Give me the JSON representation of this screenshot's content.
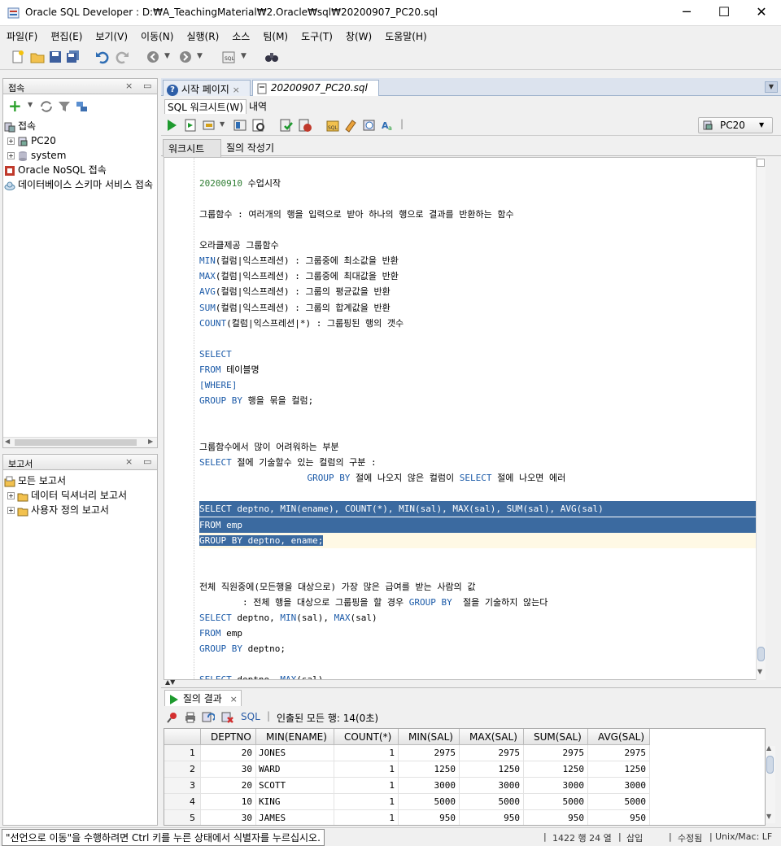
{
  "window": {
    "title": "Oracle SQL Developer : D:₩A_TeachingMaterial₩2.Oracle₩sql₩20200907_PC20.sql",
    "minimize": "─",
    "maximize": "☐",
    "close": "✕"
  },
  "menu": [
    "파일(F)",
    "편집(E)",
    "보기(V)",
    "이동(N)",
    "실행(R)",
    "소스",
    "팀(M)",
    "도구(T)",
    "창(W)",
    "도움말(H)"
  ],
  "connections": {
    "title": "접속",
    "root": "접속",
    "items": [
      "PC20",
      "system"
    ],
    "nosql": "Oracle NoSQL 접속",
    "schema": "데이터베이스 스키마 서비스 접속"
  },
  "reports": {
    "title": "보고서",
    "items": [
      "모든 보고서",
      "데이터 딕셔너리 보고서",
      "사용자 정의 보고서"
    ]
  },
  "doc_tabs": [
    {
      "label": "시작 페이지",
      "close": "×"
    },
    {
      "label": "20200907_PC20.sql",
      "close": "×"
    }
  ],
  "sub_tabs": [
    "SQL 워크시트(W)",
    "내역"
  ],
  "connection_select": "PC20",
  "worksheet_tabs": [
    "워크시트",
    "질의 작성기"
  ],
  "editor": {
    "lines": [
      [
        {
          "t": "20200910",
          "c": "num"
        },
        {
          "t": " 수업시작"
        }
      ],
      [],
      [
        {
          "t": "그룹함수 : 여러개의 행을 입력으로 받아 하나의 행으로 결과를 반환하는 함수"
        }
      ],
      [],
      [
        {
          "t": "오라클제공 그룹함수"
        }
      ],
      [
        {
          "t": "MIN",
          "c": "kw"
        },
        {
          "t": "(컬럼|익스프레션) : 그룹중에 최소값을 반환"
        }
      ],
      [
        {
          "t": "MAX",
          "c": "kw"
        },
        {
          "t": "(컬럼|익스프레션) : 그룹중에 최대값을 반환"
        }
      ],
      [
        {
          "t": "AVG",
          "c": "kw"
        },
        {
          "t": "(컬럼|익스프레션) : 그룹의 평균값을 반환"
        }
      ],
      [
        {
          "t": "SUM",
          "c": "kw"
        },
        {
          "t": "(컬럼|익스프레션) : 그룹의 합계값을 반환"
        }
      ],
      [
        {
          "t": "COUNT",
          "c": "kw"
        },
        {
          "t": "(컬럼|익스프레션|*) : 그룹핑된 행의 갯수"
        }
      ],
      [],
      [
        {
          "t": "SELECT",
          "c": "kw"
        }
      ],
      [
        {
          "t": "FROM",
          "c": "kw"
        },
        {
          "t": " 테이블명"
        }
      ],
      [
        {
          "t": "[WHERE]",
          "c": "kw"
        }
      ],
      [
        {
          "t": "GROUP BY",
          "c": "kw"
        },
        {
          "t": " 행을 묶을 컬럼;"
        }
      ],
      [],
      [],
      [
        {
          "t": "그룹함수에서 많이 어려워하는 부분"
        }
      ],
      [
        {
          "t": "SELECT",
          "c": "kw"
        },
        {
          "t": " 절에 기술할수 있는 컬럼의 구분 :"
        }
      ],
      [
        {
          "t": "                    "
        },
        {
          "t": "GROUP BY",
          "c": "kw"
        },
        {
          "t": " 절에 나오지 않은 컬럼이 "
        },
        {
          "t": "SELECT",
          "c": "kw"
        },
        {
          "t": " 절에 나오면 에러"
        }
      ],
      [],
      [
        {
          "t": "SELECT",
          "c": "kw"
        },
        {
          "t": " deptno, "
        },
        {
          "t": "MIN",
          "c": "kw"
        },
        {
          "t": "(ename), "
        },
        {
          "t": "COUNT",
          "c": "kw"
        },
        {
          "t": "(*), "
        },
        {
          "t": "MIN",
          "c": "kw"
        },
        {
          "t": "(sal), "
        },
        {
          "t": "MAX",
          "c": "kw"
        },
        {
          "t": "(sal), "
        },
        {
          "t": "SUM",
          "c": "kw"
        },
        {
          "t": "(sal), "
        },
        {
          "t": "AVG",
          "c": "kw"
        },
        {
          "t": "(sal)"
        }
      ],
      [
        {
          "t": "FROM",
          "c": "kw"
        },
        {
          "t": " emp"
        }
      ],
      [
        {
          "t": "GROUP BY",
          "c": "kw"
        },
        {
          "t": " deptno, ename;"
        }
      ],
      [],
      [],
      [
        {
          "t": "전체 직원중에(모든행을 대상으로) 가장 많은 급여를 받는 사람의 값"
        }
      ],
      [
        {
          "t": "        : 전체 행을 대상으로 그룹핑을 할 경우 "
        },
        {
          "t": "GROUP BY",
          "c": "kw"
        },
        {
          "t": "  절을 기술하지 않는다"
        }
      ],
      [
        {
          "t": "SELECT",
          "c": "kw"
        },
        {
          "t": " deptno, "
        },
        {
          "t": "MIN",
          "c": "kw"
        },
        {
          "t": "(sal), "
        },
        {
          "t": "MAX",
          "c": "kw"
        },
        {
          "t": "(sal)"
        }
      ],
      [
        {
          "t": "FROM",
          "c": "kw"
        },
        {
          "t": " emp"
        }
      ],
      [
        {
          "t": "GROUP BY",
          "c": "kw"
        },
        {
          "t": " deptno;"
        }
      ],
      [],
      [
        {
          "t": "SELECT",
          "c": "kw"
        },
        {
          "t": " deptno, "
        },
        {
          "t": "MAX",
          "c": "kw"
        },
        {
          "t": "(sal)"
        }
      ]
    ]
  },
  "results": {
    "tab": "질의 결과",
    "close": "×",
    "sql_label": "SQL",
    "fetched": "인출된 모든 행: 14(0초)",
    "columns": [
      "DEPTNO",
      "MIN(ENAME)",
      "COUNT(*)",
      "MIN(SAL)",
      "MAX(SAL)",
      "SUM(SAL)",
      "AVG(SAL)"
    ],
    "rows": [
      [
        "1",
        "20",
        "JONES",
        "1",
        "2975",
        "2975",
        "2975",
        "2975"
      ],
      [
        "2",
        "30",
        "WARD",
        "1",
        "1250",
        "1250",
        "1250",
        "1250"
      ],
      [
        "3",
        "20",
        "SCOTT",
        "1",
        "3000",
        "3000",
        "3000",
        "3000"
      ],
      [
        "4",
        "10",
        "KING",
        "1",
        "5000",
        "5000",
        "5000",
        "5000"
      ],
      [
        "5",
        "30",
        "JAMES",
        "1",
        "950",
        "950",
        "950",
        "950"
      ]
    ]
  },
  "status": {
    "message": "\"선언으로 이동\"을 수행하려면 Ctrl 키를 누른 상태에서 식별자를 누르십시오.",
    "position": "1422 행 24 열",
    "insert": "삽입",
    "modified": "수정됨",
    "eol": "Unix/Mac: LF"
  },
  "colors": {
    "keyword": "#1b5aa8",
    "number": "#2e7d32",
    "selection": "#3b6aa0"
  }
}
